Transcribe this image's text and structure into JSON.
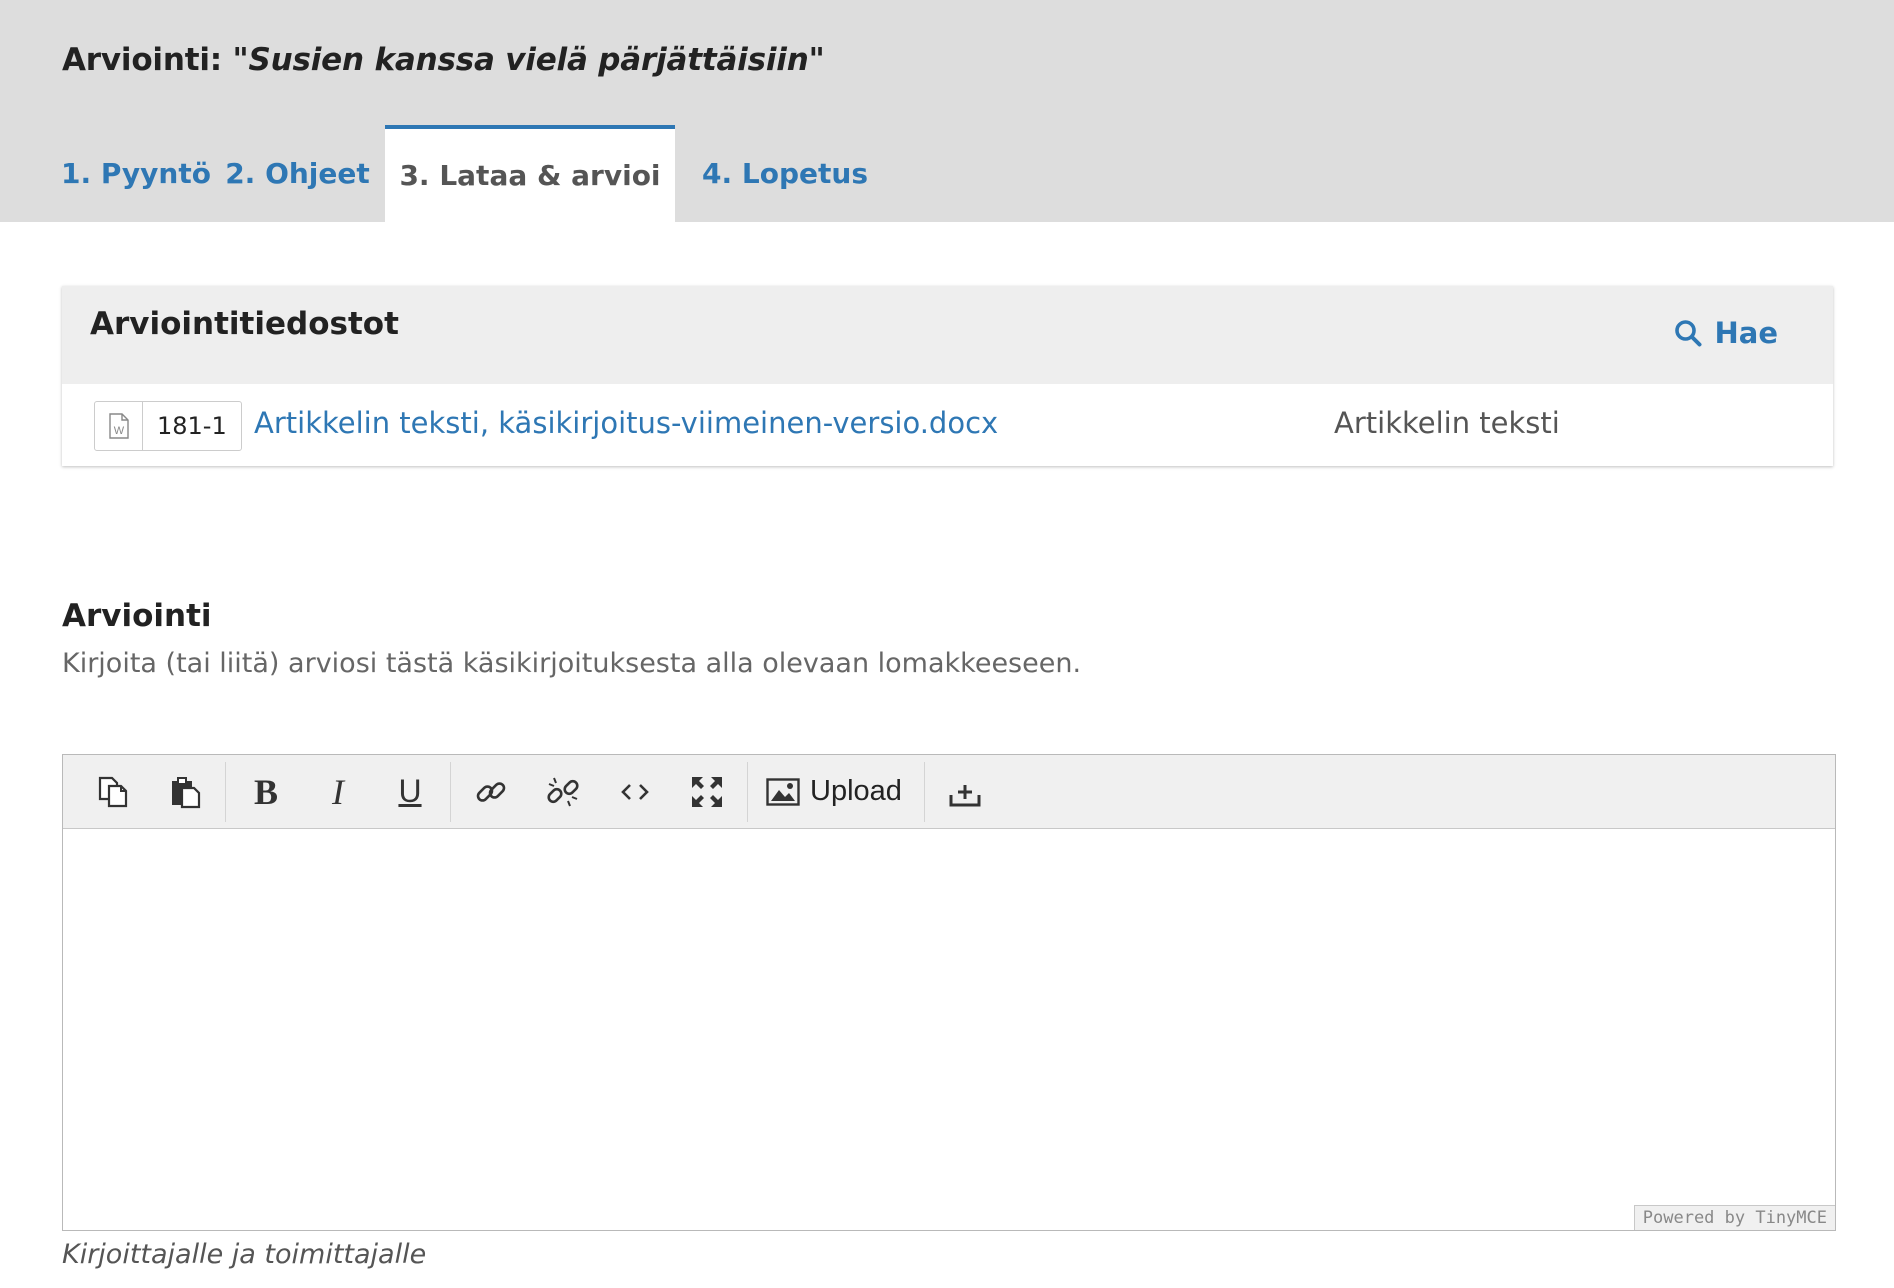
{
  "header": {
    "title_prefix": "Arviointi: ",
    "title_quoted": "\"Susien kanssa vielä pärjättäisiin\""
  },
  "tabs": [
    {
      "label": "1. Pyyntö",
      "active": false
    },
    {
      "label": "2. Ohjeet",
      "active": false
    },
    {
      "label": "3. Lataa & arvioi",
      "active": true
    },
    {
      "label": "4. Lopetus",
      "active": false
    }
  ],
  "files_panel": {
    "title": "Arviointitiedostot",
    "search_label": "Hae",
    "search_icon": "search-icon",
    "files": [
      {
        "icon": "word-document-icon",
        "id": "181-1",
        "name": "Artikkelin teksti, käsikirjoitus-viimeinen-versio.docx",
        "type": "Artikkelin teksti"
      }
    ]
  },
  "review": {
    "heading": "Arviointi",
    "description": "Kirjoita (tai liitä) arviosi tästä käsikirjoituksesta alla olevaan lomakkeeseen.",
    "editor": {
      "toolbar": {
        "copy_icon": "copy-icon",
        "paste_icon": "paste-icon",
        "bold_glyph": "B",
        "italic_glyph": "I",
        "underline_glyph": "U",
        "link_icon": "link-icon",
        "unlink_icon": "unlink-icon",
        "code_icon": "code-icon",
        "fullscreen_icon": "fullscreen-icon",
        "upload_label": "Upload",
        "upload_icon": "image-icon",
        "insert_icon": "insert-icon"
      },
      "content": "",
      "branding": "Powered by TinyMCE"
    },
    "footnote": "Kirjoittajalle ja toimittajalle"
  },
  "colors": {
    "accent": "#2e77b4",
    "header_bg": "#dddddd",
    "panel_head_bg": "#eeeeee",
    "toolbar_bg": "#f0f0f0"
  }
}
